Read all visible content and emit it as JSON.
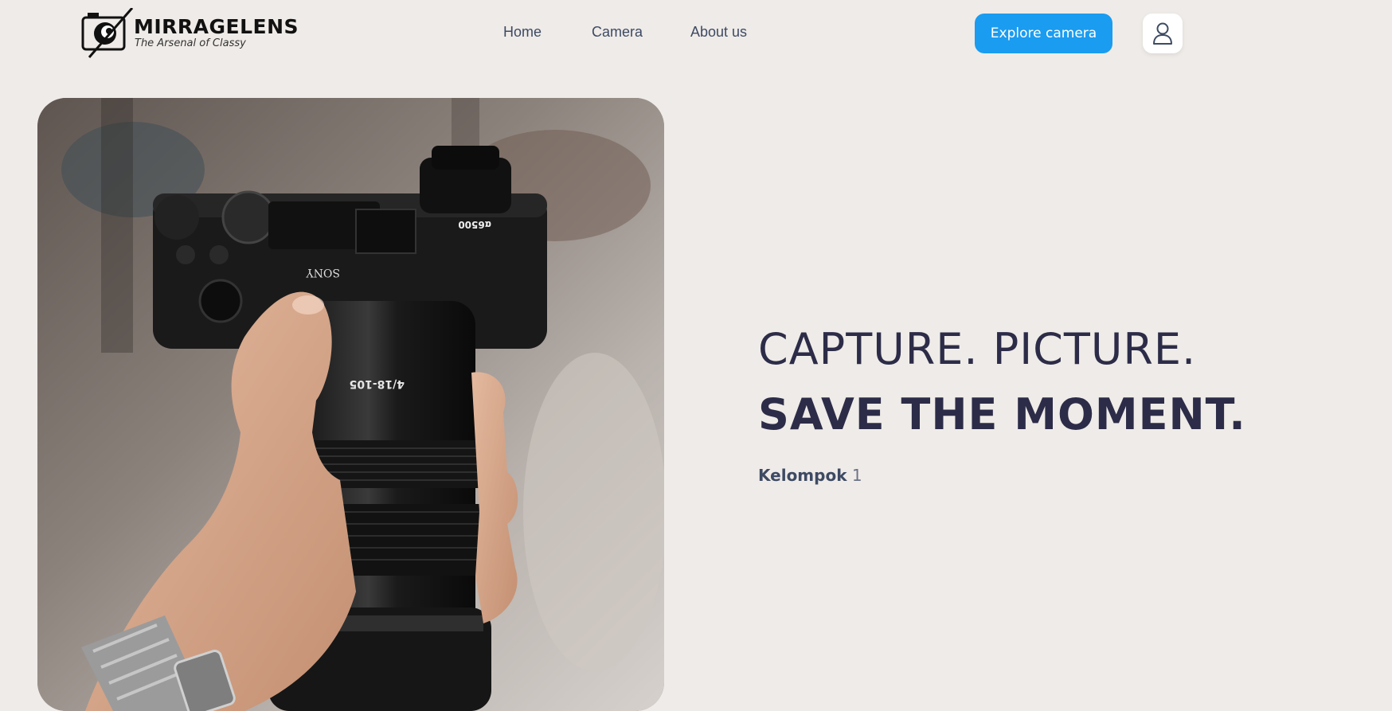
{
  "brand": {
    "name": "MIRRAGELENS",
    "tagline": "The Arsenal of Classy"
  },
  "nav": {
    "items": [
      {
        "label": "Home"
      },
      {
        "label": "Camera"
      },
      {
        "label": "About us"
      }
    ],
    "cta_label": "Explore camera",
    "user_icon": "user-icon"
  },
  "hero": {
    "headline_line1": "CAPTURE. PICTURE.",
    "headline_line2": "SAVE THE MOMENT.",
    "subtitle_bold": "Kelompok",
    "subtitle_rest": " 1",
    "image_labels": {
      "brand": "SONY",
      "model": "α6500",
      "lens": "4/18-105"
    }
  },
  "colors": {
    "background": "#efebe8",
    "accent": "#1a9cf0",
    "headline": "#2c2c48",
    "nav_text": "#3d4a63"
  }
}
